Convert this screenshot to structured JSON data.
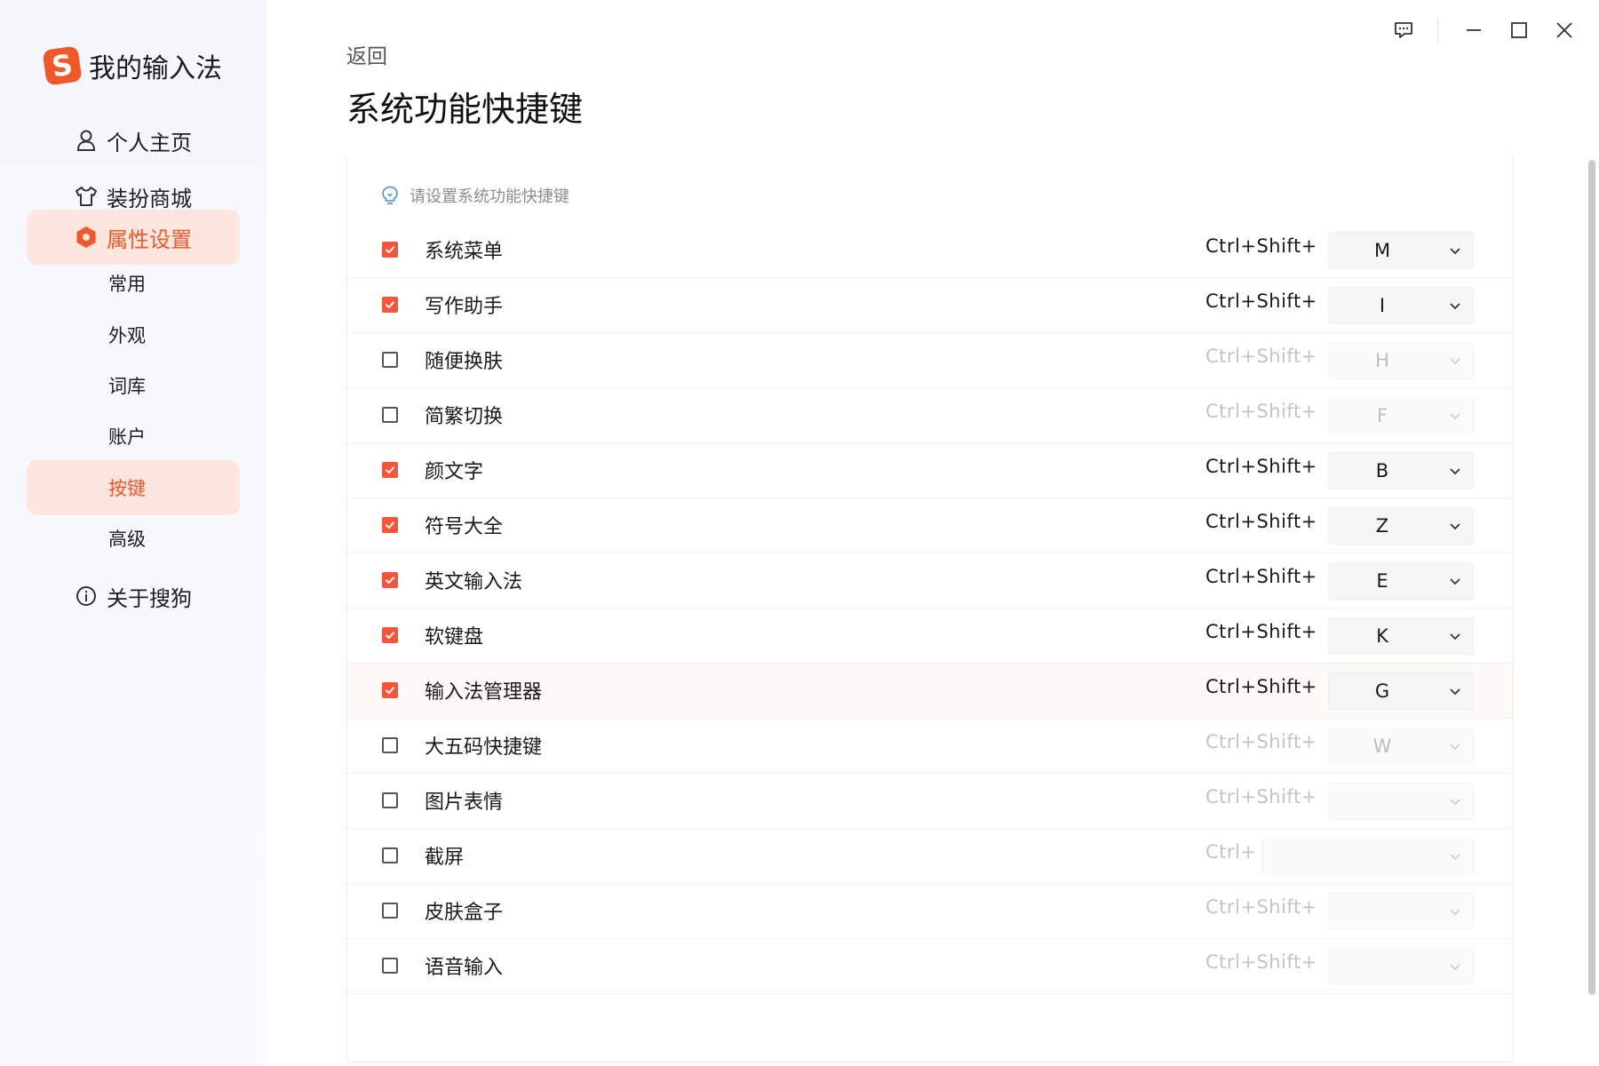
{
  "app": {
    "name": "我的输入法",
    "logo_letter": "S",
    "brand_color": "#f1582c"
  },
  "sidebar": {
    "items": [
      {
        "label": "个人主页",
        "icon": "person-icon"
      },
      {
        "label": "装扮商城",
        "icon": "shirt-icon"
      },
      {
        "label": "属性设置",
        "icon": "hexagon-gear-icon",
        "active": true
      },
      {
        "label": "关于搜狗",
        "icon": "info-icon"
      }
    ],
    "subitems": [
      {
        "label": "常用"
      },
      {
        "label": "外观"
      },
      {
        "label": "词库"
      },
      {
        "label": "账户"
      },
      {
        "label": "按键",
        "active": true
      },
      {
        "label": "高级"
      }
    ]
  },
  "window_controls": [
    "feedback-icon",
    "minimize-icon",
    "maximize-icon",
    "close-icon"
  ],
  "header": {
    "back": "返回",
    "title": "系统功能快捷键"
  },
  "panel": {
    "hint": "请设置系统功能快捷键",
    "rows": [
      {
        "label": "系统菜单",
        "checked": true,
        "modifier": "Ctrl+Shift+",
        "key": "M"
      },
      {
        "label": "写作助手",
        "checked": true,
        "modifier": "Ctrl+Shift+",
        "key": "I"
      },
      {
        "label": "随便换肤",
        "checked": false,
        "modifier": "Ctrl+Shift+",
        "key": "H"
      },
      {
        "label": "简繁切换",
        "checked": false,
        "modifier": "Ctrl+Shift+",
        "key": "F"
      },
      {
        "label": "颜文字",
        "checked": true,
        "modifier": "Ctrl+Shift+",
        "key": "B"
      },
      {
        "label": "符号大全",
        "checked": true,
        "modifier": "Ctrl+Shift+",
        "key": "Z"
      },
      {
        "label": "英文输入法",
        "checked": true,
        "modifier": "Ctrl+Shift+",
        "key": "E"
      },
      {
        "label": "软键盘",
        "checked": true,
        "modifier": "Ctrl+Shift+",
        "key": "K"
      },
      {
        "label": "输入法管理器",
        "checked": true,
        "modifier": "Ctrl+Shift+",
        "key": "G",
        "highlighted": true
      },
      {
        "label": "大五码快捷键",
        "checked": false,
        "modifier": "Ctrl+Shift+",
        "key": "W"
      },
      {
        "label": "图片表情",
        "checked": false,
        "modifier": "Ctrl+Shift+",
        "key": ""
      },
      {
        "label": "截屏",
        "checked": false,
        "modifier": "Ctrl+",
        "key": "",
        "wide_select": true
      },
      {
        "label": "皮肤盒子",
        "checked": false,
        "modifier": "Ctrl+Shift+",
        "key": ""
      },
      {
        "label": "语音输入",
        "checked": false,
        "modifier": "Ctrl+Shift+",
        "key": ""
      }
    ]
  },
  "colors": {
    "checkbox_checked": "#f5553a",
    "active_bg": "#fde6de",
    "active_text": "#f1582c"
  }
}
